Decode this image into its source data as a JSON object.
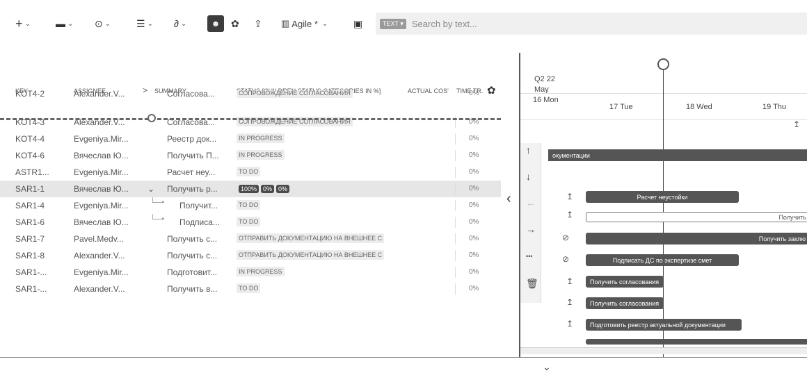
{
  "toolbar": {
    "add": "+",
    "folder": "▬",
    "view": "⊙",
    "list": "☰",
    "link": "∂",
    "team": "☻",
    "settings": "✿",
    "share": "⇪",
    "board_icon": "▥",
    "board_label": "Agile *",
    "save": "▣",
    "caret": "⌄"
  },
  "search": {
    "badge": "TEXT ▾",
    "placeholder": "Search by text..."
  },
  "columns": {
    "key": "KEY",
    "assignee": "ASSIGNEE",
    "expand": ">",
    "summary": "SUMMARY",
    "status": "STATUS [CHILDREN STATUS CATEGORIES IN %]",
    "actual_cost": "ACTUAL COS'",
    "time": "TIME TR.",
    "gear": "✿"
  },
  "rows": [
    {
      "key": "KOT4-2",
      "assignee": "Alexander.V...",
      "summary": "Согласова...",
      "status": "СОПРОВОЖДЕНИЕ СОГЛАСОВАНИЯ",
      "time": "0%"
    },
    {
      "key": "KOT4-3",
      "assignee": "Alexander.V...",
      "summary": "Согласова...",
      "status": "СОПРОВОЖДЕНИЕ СОГЛАСОВАНИЯ",
      "time": "0%"
    },
    {
      "key": "KOT4-4",
      "assignee": "Evgeniya.Mir...",
      "summary": "Реестр док...",
      "status": "IN PROGRESS",
      "time": "0%"
    },
    {
      "key": "KOT4-6",
      "assignee": "Вячеслав Ю...",
      "summary": "Получить П...",
      "status": "IN PROGRESS",
      "time": "0%"
    },
    {
      "key": "ASTR1...",
      "assignee": "Evgeniya.Mir...",
      "summary": "Расчет неу...",
      "status": "TO DO",
      "time": "0%"
    },
    {
      "key": "SAR1-1",
      "assignee": "Вячеслав Ю...",
      "summary": "Получить р...",
      "expand": "⌄",
      "pcts": [
        "100%",
        "0%",
        "0%"
      ],
      "time": "0%"
    },
    {
      "key": "SAR1-4",
      "assignee": "Evgeniya.Mir...",
      "summary": "Получит...",
      "status": "TO DO",
      "time": "0%"
    },
    {
      "key": "SAR1-6",
      "assignee": "Вячеслав Ю...",
      "summary": "Подписа...",
      "status": "TO DO",
      "time": "0%"
    },
    {
      "key": "SAR1-7",
      "assignee": "Pavel.Medv...",
      "summary": "Получить с...",
      "status": "ОТПРАВИТЬ ДОКУМЕНТАЦИЮ НА ВНЕШНЕЕ С",
      "time": "0%"
    },
    {
      "key": "SAR1-8",
      "assignee": "Alexander.V...",
      "summary": "Получить с...",
      "status": "ОТПРАВИТЬ ДОКУМЕНТАЦИЮ НА ВНЕШНЕЕ С",
      "time": "0%"
    },
    {
      "key": "SAR1-...",
      "assignee": "Evgeniya.Mir...",
      "summary": "Подготовит...",
      "status": "IN PROGRESS",
      "time": "0%"
    },
    {
      "key": "SAR1-...",
      "assignee": "Alexander.V...",
      "summary": "Получить в...",
      "status": "TO DO",
      "time": "0%"
    }
  ],
  "gantt": {
    "quarter": "Q2 22",
    "month": "May",
    "days": [
      "16 Mon",
      "17 Tue",
      "18 Wed",
      "19 Thu"
    ],
    "collapse": "‹",
    "bars": [
      {
        "label": "окументации"
      },
      {
        "label": "Расчет неустойки"
      },
      {
        "label": "Получить"
      },
      {
        "label": "Получить заклю"
      },
      {
        "label": "Подписать ДС по экспертизе смет"
      },
      {
        "label": "Получить согласования"
      },
      {
        "label": "Получить согласования"
      },
      {
        "label": "Подготовить реестр актуальной документации"
      }
    ],
    "side": {
      "up": "↑",
      "down": "↓",
      "left": "←",
      "right": "→",
      "more": "•••",
      "delete": "🗑"
    },
    "row_icon": "↥",
    "block_icon": "⊘"
  },
  "footer_mark": "⌄"
}
